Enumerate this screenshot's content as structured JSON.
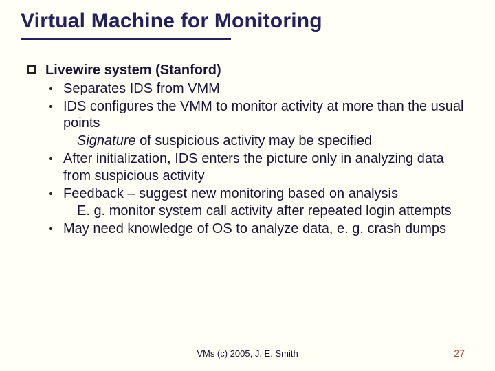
{
  "title": "Virtual Machine for Monitoring",
  "main_bullet": "Livewire system (Stanford)",
  "points": {
    "p1": "Separates IDS from VMM",
    "p2": "IDS configures the VMM to monitor activity at more than the usual points",
    "p2_sub_italic": "Signature",
    "p2_sub_rest": " of suspicious activity may be specified",
    "p3": "After initialization, IDS enters the picture only in analyzing data from suspicious activity",
    "p4": "Feedback – suggest new monitoring based on analysis",
    "p4_sub": "E. g. monitor system call activity after repeated login attempts",
    "p5": "May need knowledge of OS to analyze data, e. g. crash dumps"
  },
  "footer": "VMs (c) 2005, J. E. Smith",
  "page_number": "27"
}
